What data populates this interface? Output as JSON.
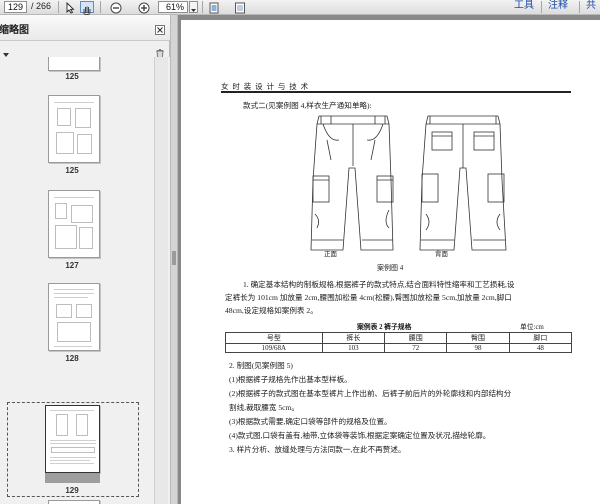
{
  "toolbar": {
    "page_current": "129",
    "page_total": "/ 266",
    "zoom": "61%",
    "tools_label": "工具",
    "comment_label": "注释",
    "share_label": "共"
  },
  "panel": {
    "title": "缩略图"
  },
  "thumbnails": [
    {
      "label": "125"
    },
    {
      "label": "125"
    },
    {
      "label": "127"
    },
    {
      "label": "128"
    },
    {
      "label": "129"
    }
  ],
  "document": {
    "header": "女 时 装 设 计 与 技 术",
    "style_heading": "款式二(见案例图 4,样衣生产通知单略):",
    "front_caption": "正面",
    "back_caption": "背面",
    "figure_caption": "案例图 4",
    "para1": [
      "1. 确定基本结构的制板规格,根据裤子的款式特点,结合面料特性缩率和工艺损耗,设",
      "定裤长为 101cm 加放量 2cm,腰围加松量 4cm(松腰),臀围加放松量 5cm,加放量 2cm,脚口",
      "48cm,设定规格如案例表 2。"
    ],
    "table_title": "案例表 2   裤子规格",
    "table_unit": "单位:cm",
    "table_headers": [
      "号型",
      "裤长",
      "腰围",
      "臀围",
      "脚口"
    ],
    "table_row": [
      "109/68A",
      "103",
      "72",
      "98",
      "48"
    ],
    "para2": [
      "2. 制图(见案例图 5)",
      "(1)根据裤子规格先作出基本型样板。",
      "(2)根据裤子的款式图在基本型裤片上作出前、后裤子前后片的外轮廓线和内部结构分",
      "割线,裁取腰宽 5cm。",
      "(3)根据款式需要,确定口袋等部件的规格及位置。",
      "(4)款式图,口袋有盖有,袖带,立体袋等装饰,根据定案确定位置及状况,描绘轮廓。",
      "3. 样片分析、放缝处理与方法同款一,在此不再赘述。"
    ]
  }
}
